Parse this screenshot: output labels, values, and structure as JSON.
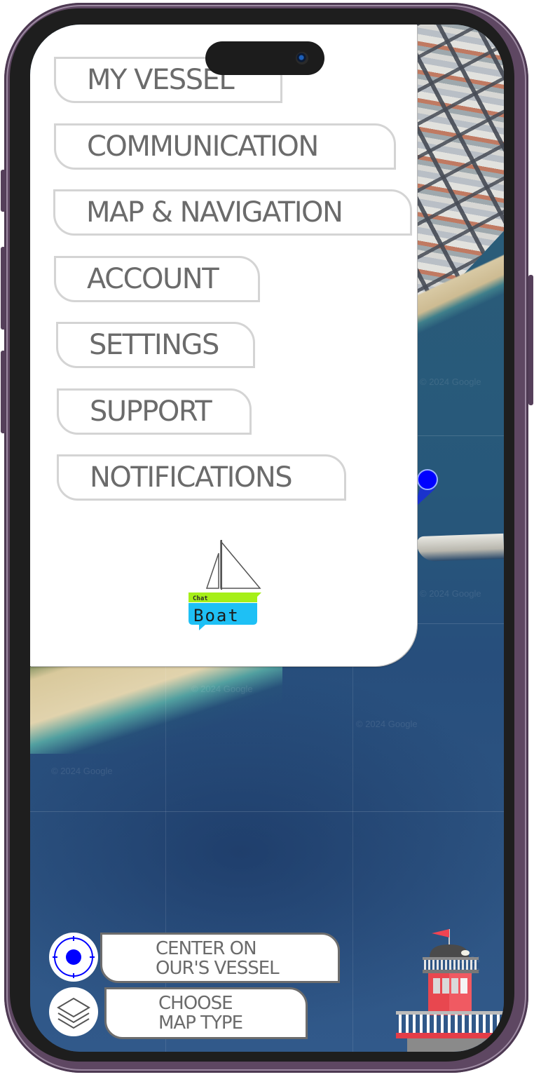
{
  "app": {
    "name": "Chat Boat",
    "logo": {
      "small_text": "Chat",
      "large_text": "Boat",
      "colors": {
        "green": "#a6ef18",
        "blue": "#1ec0f5",
        "outline": "#555555"
      }
    }
  },
  "menu": {
    "items": [
      {
        "id": "my-vessel",
        "label": "MY VESSEL"
      },
      {
        "id": "communication",
        "label": "COMMUNICATION"
      },
      {
        "id": "map-navigation",
        "label": "MAP & NAVIGATION"
      },
      {
        "id": "account",
        "label": "ACCOUNT"
      },
      {
        "id": "settings",
        "label": "SETTINGS"
      },
      {
        "id": "support",
        "label": "SUPPORT"
      },
      {
        "id": "notifications",
        "label": "NOTIFICATIONS"
      }
    ]
  },
  "map": {
    "type": "satellite",
    "watermark": "© 2024 Google",
    "vessel_marker_color": "#0000ff"
  },
  "controls": {
    "center_vessel": {
      "icon": "crosshair-target-icon",
      "line1": "CENTER ON",
      "line2": "OUR'S VESSEL",
      "icon_color": "#0000ff"
    },
    "map_type": {
      "icon": "layers-icon",
      "line1": "CHOOSE",
      "line2": "MAP TYPE"
    }
  },
  "decoration": {
    "lighthouse_colors": {
      "body": "#e8474f",
      "dome": "#4a4a4a",
      "flag": "#f04452"
    }
  }
}
